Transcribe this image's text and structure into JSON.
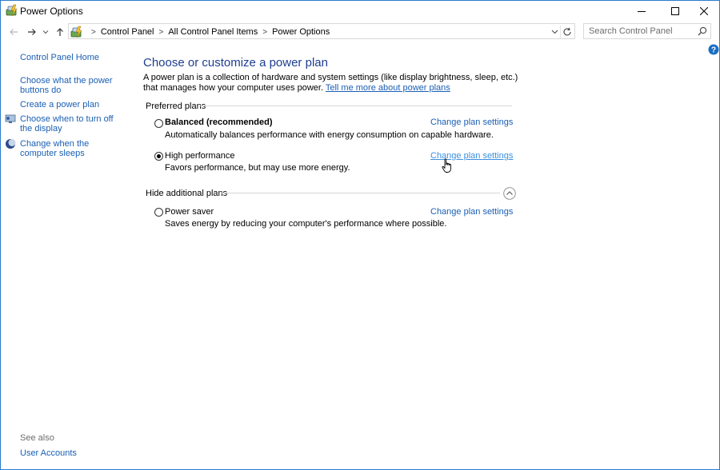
{
  "window": {
    "title": "Power Options"
  },
  "address_bar": {
    "crumbs": [
      "Control Panel",
      "All Control Panel Items",
      "Power Options"
    ]
  },
  "search": {
    "placeholder": "Search Control Panel",
    "value": ""
  },
  "left_nav": {
    "home": "Control Panel Home",
    "power_buttons": "Choose what the power buttons do",
    "create_plan": "Create a power plan",
    "turn_off_display": "Choose when to turn off the display",
    "computer_sleeps": "Change when the computer sleeps",
    "see_also_label": "See also",
    "user_accounts": "User Accounts"
  },
  "main": {
    "title": "Choose or customize a power plan",
    "description": "A power plan is a collection of hardware and system settings (like display brightness, sleep, etc.) that manages how your computer uses power.",
    "learn_more_link": "Tell me more about power plans",
    "preferred_header": "Preferred plans",
    "additional_header": "Hide additional plans",
    "plans": [
      {
        "name": "Balanced (recommended)",
        "description": "Automatically balances performance with energy consumption on capable hardware.",
        "link": "Change plan settings",
        "selected": false
      },
      {
        "name": "High performance",
        "description": "Favors performance, but may use more energy.",
        "link": "Change plan settings",
        "selected": true
      },
      {
        "name": "Power saver",
        "description": "Saves energy by reducing your computer's performance where possible.",
        "link": "Change plan settings",
        "selected": false
      }
    ]
  },
  "colors": {
    "link": "#1a5fb4",
    "title": "#1e3d8f",
    "window_border": "#2b7bd0",
    "help": "#1b6ec2"
  },
  "icons": {
    "app": "power-options-icon",
    "minimize": "minimize-icon",
    "maximize": "maximize-icon",
    "close": "close-icon",
    "back": "back-arrow-icon",
    "forward": "forward-arrow-icon",
    "recent": "chevron-down-icon",
    "up": "up-arrow-icon",
    "refresh": "refresh-icon",
    "search": "search-icon",
    "help": "help-icon"
  }
}
